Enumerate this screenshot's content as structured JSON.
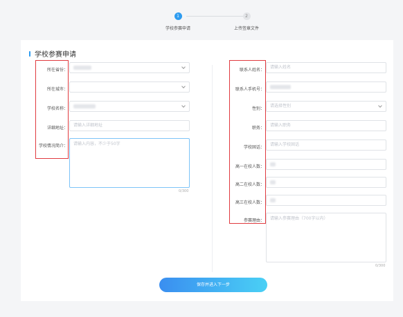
{
  "stepper": {
    "steps": [
      {
        "num": "1",
        "label": "学校参赛申请"
      },
      {
        "num": "2",
        "label": "上传签章文件"
      }
    ]
  },
  "form": {
    "title": "学校参赛申请",
    "left": [
      {
        "label": "所在省份：",
        "type": "select",
        "value": ""
      },
      {
        "label": "所在城市：",
        "type": "select",
        "value": ""
      },
      {
        "label": "学校名称：",
        "type": "select",
        "value": ""
      },
      {
        "label": "详细地址：",
        "type": "input",
        "placeholder": "请输入详细地址"
      },
      {
        "label": "学校情况简介：",
        "type": "textarea",
        "placeholder": "请输入内容，不少于50字",
        "counter": "0/300"
      }
    ],
    "right": [
      {
        "label": "联系人姓名：",
        "type": "input",
        "placeholder": "请输入姓名"
      },
      {
        "label": "联系人手机号：",
        "type": "input",
        "placeholder": ""
      },
      {
        "label": "性别：",
        "type": "select",
        "placeholder": "请选择性别"
      },
      {
        "label": "职务：",
        "type": "input",
        "placeholder": "请输入职务"
      },
      {
        "label": "学校固话：",
        "type": "input",
        "placeholder": "请输入学校固话"
      },
      {
        "label": "高一在校人数：",
        "type": "input",
        "placeholder": ""
      },
      {
        "label": "高二在校人数：",
        "type": "input",
        "placeholder": ""
      },
      {
        "label": "高三在校人数：",
        "type": "input",
        "placeholder": ""
      },
      {
        "label": "参赛理由：",
        "type": "textarea",
        "placeholder": "请输入参赛理由（700字以内）",
        "counter": "0/300"
      }
    ],
    "submit_label": "保存并进入下一步"
  }
}
